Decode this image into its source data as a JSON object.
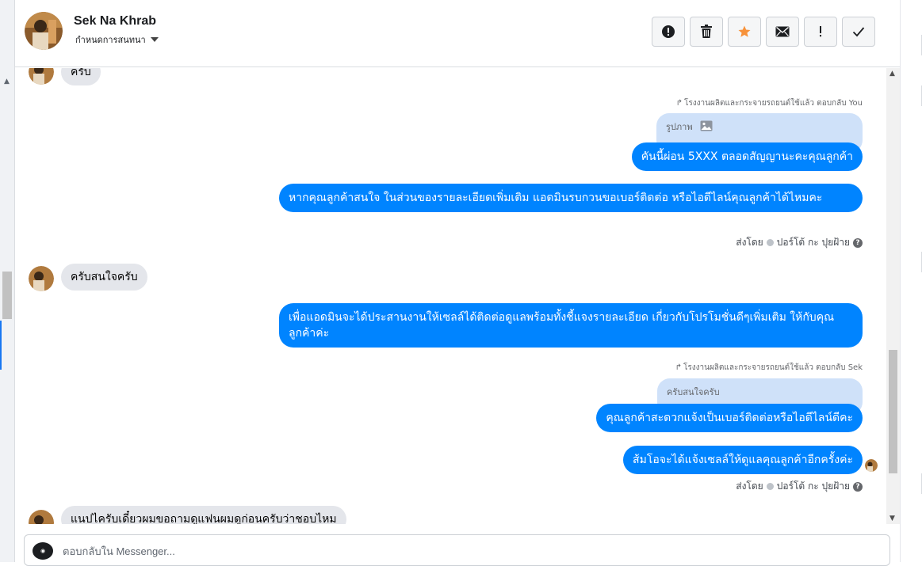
{
  "header": {
    "contact_name": "Sek Na Khrab",
    "assign_label": "กำหนดการสนทนา"
  },
  "actions": [
    {
      "icon": "alert-circle-icon",
      "label": "Mark as spam"
    },
    {
      "icon": "trash-icon",
      "label": "Delete"
    },
    {
      "icon": "star-icon",
      "label": "Star"
    },
    {
      "icon": "envelope-icon",
      "label": "Mark as unread"
    },
    {
      "icon": "exclamation-icon",
      "label": "Flag"
    },
    {
      "icon": "check-icon",
      "label": "Mark as done"
    }
  ],
  "colors": {
    "outgoing_bubble": "#0084ff",
    "incoming_bubble": "#e4e6eb",
    "quoted_bubble": "#cfe1f9",
    "star": "#f7923a"
  },
  "messages": {
    "m1": {
      "text": "ครับ"
    },
    "reply1": {
      "note": "โรงงานผลิตและกระจายรถยนต์ใช้แล้ว ตอบกลับ You"
    },
    "quoted1": {
      "text": "รูปภาพ",
      "icon": "image-icon"
    },
    "m2": {
      "text": "คันนี้ผ่อน 5XXX ตลอดสัญญานะคะคุณลูกค้า"
    },
    "m3": {
      "text": "หากคุณลูกค้าสนใจ ในส่วนของรายละเอียดเพิ่มเติม แอดมินรบกวนขอเบอร์ติดต่อ หรือไอดีไลน์คุณลูกค้าได้ไหมคะ"
    },
    "sent1": {
      "prefix": "ส่งโดย",
      "sender": "ปอร์โต้ กะ ปุยฝ้าย"
    },
    "m4": {
      "text": "ครับสนใจครับ"
    },
    "m5": {
      "text": "เพื่อแอดมินจะได้ประสานงานให้เซลล์ได้ติดต่อดูแลพร้อมทั้งชี้แจงรายละเอียด เกี่ยวกับโปรโมชั่นดีๆเพิ่มเติม ให้กับคุณลูกค้าค่ะ"
    },
    "reply2": {
      "note": "โรงงานผลิตและกระจายรถยนต์ใช้แล้ว ตอบกลับ Sek"
    },
    "quoted2": {
      "text": "ครับสนใจครับ"
    },
    "m6": {
      "text": "คุณลูกค้าสะดวกแจ้งเป็นเบอร์ติดต่อหรือไอดีไลน์ดีคะ"
    },
    "m7": {
      "text": "ส้มโอจะได้แจ้งเซลล์ให้ดูแลคุณลูกค้าอีกครั้งค่ะ"
    },
    "sent2": {
      "prefix": "ส่งโดย",
      "sender": "ปอร์โต้ กะ ปุยฝ้าย"
    },
    "m8": {
      "text": "แนปไครับเดี๋ยวผมขอถามดูแฟนผมดูก่อนครับว่าชอบไหม"
    }
  },
  "composer": {
    "placeholder": "ตอบกลับใน Messenger..."
  }
}
